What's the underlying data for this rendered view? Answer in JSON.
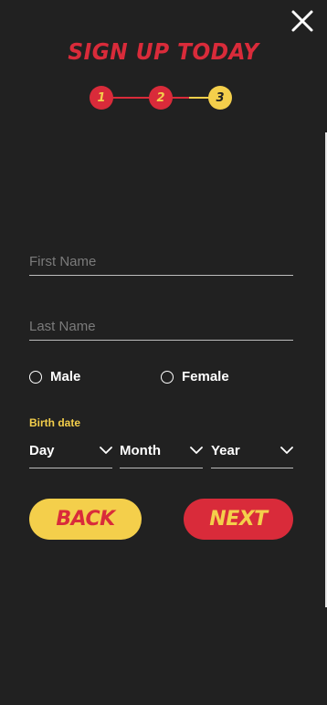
{
  "header": {
    "title": "SIGN UP TODAY",
    "close_icon": "close-icon"
  },
  "stepper": {
    "steps": [
      {
        "label": "1",
        "state": "completed"
      },
      {
        "label": "2",
        "state": "completed"
      },
      {
        "label": "3",
        "state": "current"
      }
    ]
  },
  "form": {
    "first_name": {
      "placeholder": "First Name",
      "value": ""
    },
    "last_name": {
      "placeholder": "Last Name",
      "value": ""
    },
    "gender": {
      "options": [
        {
          "label": "Male",
          "selected": false
        },
        {
          "label": "Female",
          "selected": false
        }
      ]
    },
    "birth_date": {
      "label": "Birth date",
      "day": "Day",
      "month": "Month",
      "year": "Year"
    }
  },
  "actions": {
    "back_label": "BACK",
    "next_label": "NEXT"
  },
  "colors": {
    "background": "#212121",
    "red": "#d92b3a",
    "yellow": "#f4cf4b",
    "text": "#ffffff",
    "placeholder": "#7b7b7b"
  }
}
